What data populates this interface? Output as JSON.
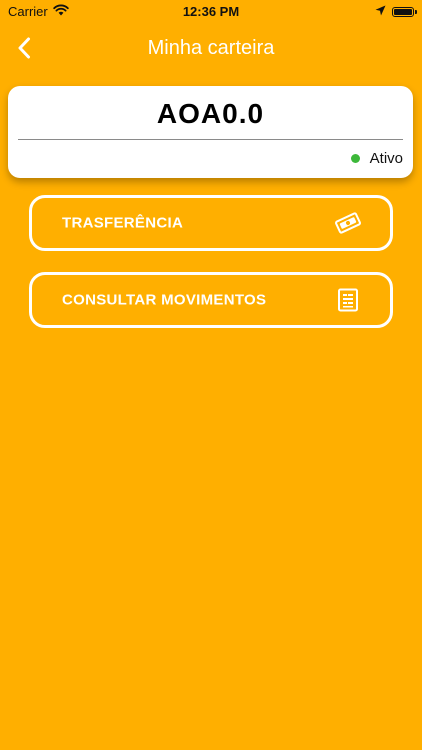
{
  "status_bar": {
    "carrier": "Carrier",
    "time": "12:36 PM"
  },
  "nav": {
    "title": "Minha carteira",
    "back_icon": "chevron-left-icon"
  },
  "wallet": {
    "balance": "AOA0.0",
    "status": "Ativo",
    "status_color": "#3DB83A"
  },
  "actions": [
    {
      "label": "TRASFERÊNCIA",
      "icon": "money-transfer-icon"
    },
    {
      "label": "CONSULTAR MOVIMENTOS",
      "icon": "receipt-icon"
    }
  ],
  "colors": {
    "background": "#FFAF00",
    "card": "#FFFFFF",
    "accent_text": "#FFFFFF"
  }
}
